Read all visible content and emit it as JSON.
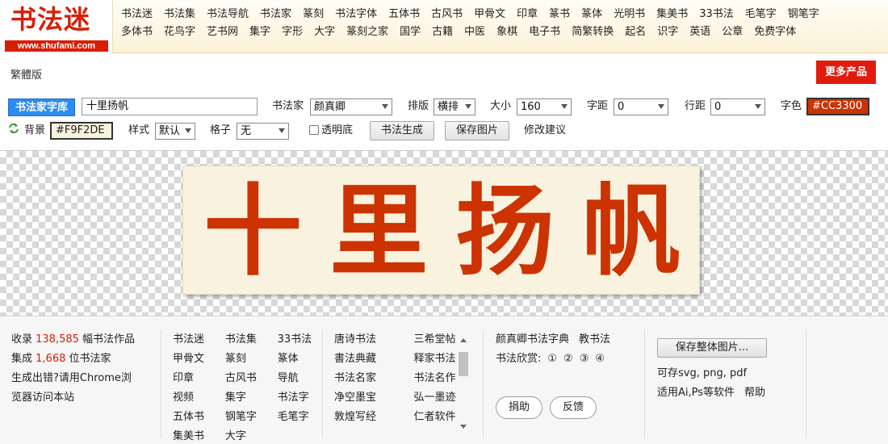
{
  "logo": {
    "title": "书法迷",
    "url": "www.shufami.com"
  },
  "nav": {
    "row1": [
      "书法迷",
      "书法集",
      "书法导航",
      "书法家",
      "篆刻",
      "书法字体",
      "五体书",
      "古风书",
      "甲骨文",
      "印章",
      "篆书",
      "篆体",
      "光明书",
      "集美书",
      "33书法",
      "毛笔字",
      "钢笔字"
    ],
    "row2": [
      "多体书",
      "花鸟字",
      "艺书网",
      "集字",
      "字形",
      "大字",
      "篆刻之家",
      "国学",
      "古籍",
      "中医",
      "象棋",
      "电子书",
      "简繁转换",
      "起名",
      "识字",
      "英语",
      "公章",
      "免费字体"
    ]
  },
  "top": {
    "traditional": "繁體版",
    "more_products": "更多产品"
  },
  "toolbar": {
    "library_button": "书法家字库",
    "text_value": "十里扬帆",
    "calligrapher_label": "书法家",
    "calligrapher_value": "颜真卿",
    "layout_label": "排版",
    "layout_value": "横排",
    "size_label": "大小",
    "size_value": "160",
    "spacing_label": "字距",
    "spacing_value": "0",
    "line_label": "行距",
    "line_value": "0",
    "color_label": "字色",
    "color_value": "#CC3300",
    "bg_label": "背景",
    "bg_value": "#F9F2DE",
    "style_label": "样式",
    "style_value": "默认",
    "grid_label": "格子",
    "grid_value": "无",
    "transparent_label": "透明底",
    "generate_button": "书法生成",
    "save_button": "保存图片",
    "suggest_link": "修改建议"
  },
  "canvas": {
    "characters": [
      "十",
      "里",
      "扬",
      "帆"
    ],
    "char_color": "#CC3300",
    "bg_color": "#F9F2DE"
  },
  "footer": {
    "stats": {
      "collected_prefix": "收录 ",
      "collected_num": "138,585",
      "collected_suffix": " 幅书法作品",
      "artists_prefix": "集成 ",
      "artists_num": "1,668",
      "artists_suffix": " 位书法家",
      "error_line1": "生成出错?请用Chrome浏",
      "error_line2": "览器访问本站"
    },
    "links_a": [
      "书法迷",
      "书法集",
      "33书法",
      "甲骨文",
      "篆刻",
      "篆体",
      "印章",
      "古风书",
      "导航",
      "视频",
      "集字",
      "书法字",
      "五体书",
      "钢笔字",
      "毛笔字",
      "集美书",
      "大字"
    ],
    "links_b": [
      "唐诗书法",
      "三希堂帖",
      "書法典藏",
      "释家书法",
      "书法名家",
      "书法名作",
      "净空墨宝",
      "弘一墨迹",
      "敦煌写经",
      "仁者软件"
    ],
    "dict_link": "颜真卿书法字典",
    "teach_link": "教书法",
    "appreciate_label": "书法欣赏:",
    "appreciate_items": [
      "①",
      "②",
      "③",
      "④"
    ],
    "donate_button": "捐助",
    "feedback_button": "反馈",
    "save_all_button": "保存整体图片...",
    "save_formats": "可存svg, png, pdf",
    "software_text": "适用Ai,Ps等软件",
    "help_link": "帮助"
  }
}
